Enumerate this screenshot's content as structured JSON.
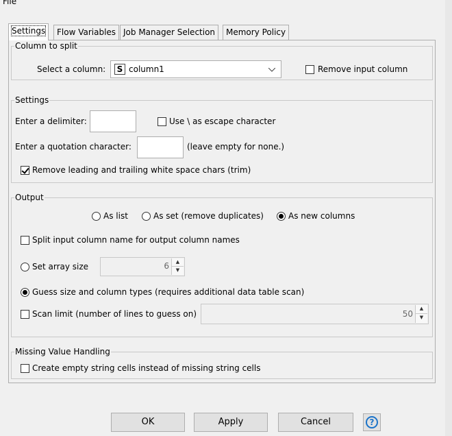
{
  "menubar": {
    "file_label": "File"
  },
  "tabs": [
    {
      "label": "Settings",
      "active": true
    },
    {
      "label": "Flow Variables",
      "active": false
    },
    {
      "label": "Job Manager Selection",
      "active": false
    },
    {
      "label": "Memory Policy",
      "active": false
    }
  ],
  "column_to_split": {
    "legend": "Column to split",
    "select_label": "Select a column:",
    "type_icon": "S",
    "selected_column": "column1",
    "remove_input_label": "Remove input column",
    "remove_input_checked": false
  },
  "settings": {
    "legend": "Settings",
    "delimiter_label": "Enter a delimiter:",
    "delimiter_value": "",
    "escape_label": "Use \\ as escape character",
    "escape_checked": false,
    "quote_label": "Enter a quotation character:",
    "quote_value": "",
    "quote_hint": "(leave empty for none.)",
    "trim_label": "Remove leading and trailing white space chars (trim)",
    "trim_checked": true
  },
  "output": {
    "legend": "Output",
    "radio_list": "As list",
    "radio_set": "As set (remove duplicates)",
    "radio_columns": "As new columns",
    "selected_output": "As new columns",
    "split_names_label": "Split input column name for output column names",
    "split_names_checked": false,
    "array_size_label": "Set array size",
    "array_size_value": "6",
    "array_size_selected": false,
    "guess_label": "Guess size and column types (requires additional data table scan)",
    "guess_selected": true,
    "scan_limit_label": "Scan limit (number of lines to guess on)",
    "scan_limit_checked": false,
    "scan_limit_value": "50"
  },
  "missing": {
    "legend": "Missing Value Handling",
    "empty_string_label": "Create empty string cells instead of missing string cells",
    "empty_string_checked": false
  },
  "buttons": {
    "ok": "OK",
    "apply": "Apply",
    "cancel": "Cancel",
    "help": "?"
  },
  "icons": {
    "dropdown": "chevron-down-icon",
    "spinner_up": "caret-up-icon",
    "spinner_down": "caret-down-icon",
    "help": "help-icon"
  },
  "colors": {
    "help_accent": "#1a73c9",
    "window_bg": "#f0f0f0"
  }
}
